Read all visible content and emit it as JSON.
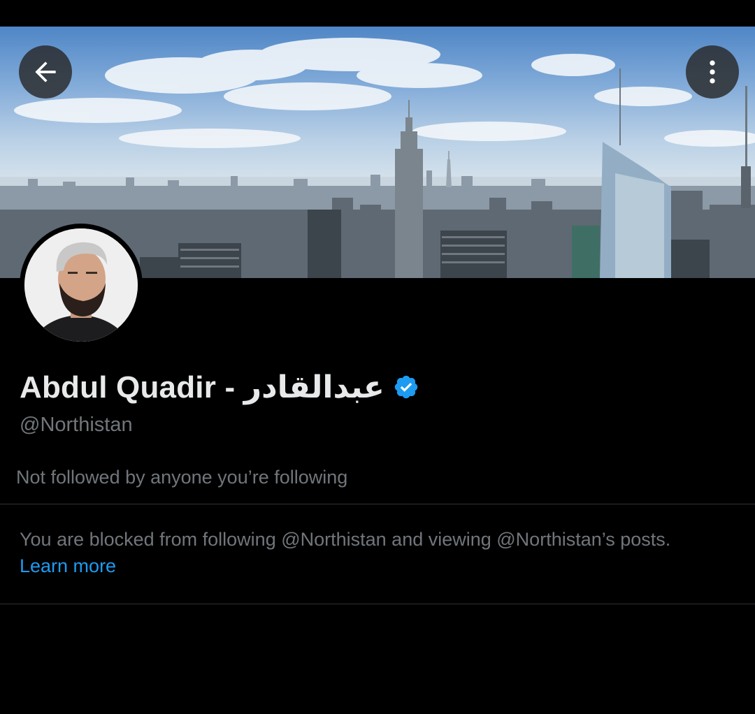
{
  "profile": {
    "display_name": "Abdul Quadir - عبدالقادر",
    "handle": "@Northistan",
    "followers_context": "Not followed by anyone you’re following",
    "verified_color": "#1d9bf0"
  },
  "blocked": {
    "message": "You are blocked from following @Northistan and viewing @Northistan’s posts.",
    "learn_more": "Learn more"
  },
  "icons": {
    "back": "back-arrow-icon",
    "more": "more-vertical-icon",
    "verified": "verified-badge-icon"
  },
  "colors": {
    "background": "#000000",
    "primary_text": "#e7e9ea",
    "secondary_text": "#71767b",
    "link": "#1d9bf0",
    "divider": "#2f3336"
  }
}
